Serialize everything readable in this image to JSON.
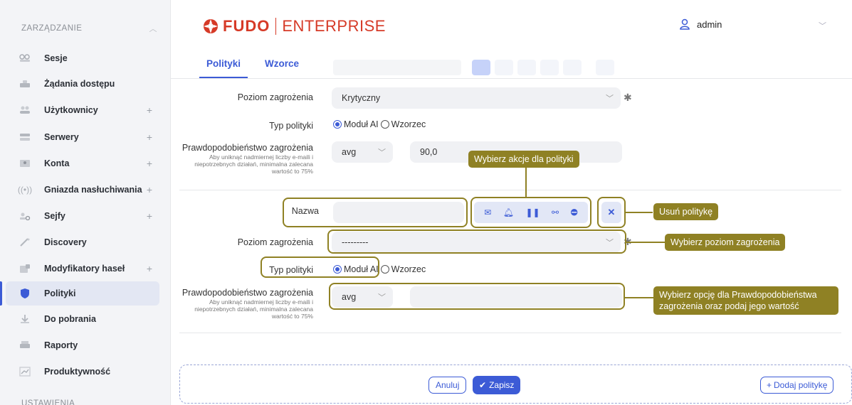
{
  "sidebar": {
    "section_title": "ZARZĄDZANIE",
    "items": [
      {
        "label": "Sesje",
        "icon": "sessions-icon",
        "plus": ""
      },
      {
        "label": "Żądania dostępu",
        "icon": "access-requests-icon",
        "plus": ""
      },
      {
        "label": "Użytkownicy",
        "icon": "users-icon",
        "plus": "+"
      },
      {
        "label": "Serwery",
        "icon": "servers-icon",
        "plus": "+"
      },
      {
        "label": "Konta",
        "icon": "accounts-icon",
        "plus": "+"
      },
      {
        "label": "Gniazda nasłuchiwania",
        "icon": "listeners-icon",
        "plus": "+"
      },
      {
        "label": "Sejfy",
        "icon": "safes-icon",
        "plus": "+"
      },
      {
        "label": "Discovery",
        "icon": "discovery-icon",
        "plus": ""
      },
      {
        "label": "Modyfikatory haseł",
        "icon": "password-changers-icon",
        "plus": "+"
      },
      {
        "label": "Polityki",
        "icon": "shield-icon",
        "plus": "",
        "active": true
      },
      {
        "label": "Do pobrania",
        "icon": "download-icon",
        "plus": ""
      },
      {
        "label": "Raporty",
        "icon": "reports-icon",
        "plus": ""
      },
      {
        "label": "Produktywność",
        "icon": "productivity-icon",
        "plus": ""
      }
    ],
    "bottom_section": "USTAWIENIA"
  },
  "header": {
    "logo_brand": "FUDO",
    "logo_suffix": "ENTERPRISE",
    "user_name": "admin"
  },
  "tabs": [
    {
      "label": "Polityki",
      "active": true
    },
    {
      "label": "Wzorce",
      "active": false
    }
  ],
  "policy1": {
    "threat_level_label": "Poziom zagrożenia",
    "threat_level_value": "Krytyczny",
    "policy_type_label": "Typ polityki",
    "radio_ai": "Moduł AI",
    "radio_pattern": "Wzorzec",
    "probability_label": "Prawdopodobieństwo zagrożenia",
    "probability_hint": "Aby uniknąć nadmiernej liczby e-maili i niepotrzebnych działań, minimalna zalecana wartość to 75%",
    "probability_mode": "avg",
    "probability_value": "90,0"
  },
  "policy2": {
    "name_label": "Nazwa",
    "name_value": "",
    "threat_level_label": "Poziom zagrożenia",
    "threat_level_value": "---------",
    "policy_type_label": "Typ polityki",
    "radio_ai": "Moduł AI",
    "radio_pattern": "Wzorzec",
    "probability_label": "Prawdopodobieństwo zagrożenia",
    "probability_hint": "Aby uniknąć nadmiernej liczby e-maili i niepotrzebnych działań, minimalna zalecana wartość to 75%",
    "probability_mode": "avg",
    "probability_value": ""
  },
  "callouts": {
    "actions": "Wybierz akcje dla polityki",
    "delete": "Usuń politykę",
    "threat": "Wybierz poziom zagrożenia",
    "probability": "Wybierz opcję dla Prawdopodobieństwa zagrożenia oraz podaj jego wartość"
  },
  "footer": {
    "cancel": "Anuluj",
    "save": "Zapisz",
    "add": "Dodaj politykę"
  },
  "colors": {
    "accent": "#3c5bd6",
    "brand": "#d63a27",
    "callout": "#8f8124"
  }
}
